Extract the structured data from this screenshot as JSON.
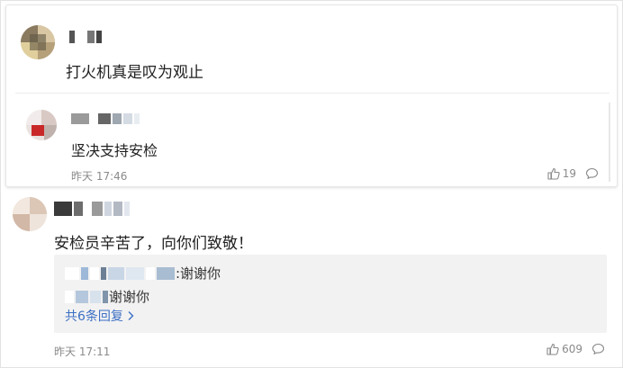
{
  "comments": [
    {
      "text": "打火机真是叹为观止",
      "reply": {
        "text": "坚决支持安检",
        "time": "昨天 17:46",
        "likes": "19"
      }
    },
    {
      "text": "安检员辛苦了，向你们致敬！",
      "replies_preview": [
        {
          "suffix": ":谢谢你"
        },
        {
          "suffix": "谢谢你"
        }
      ],
      "more_replies": "共6条回复",
      "time": "昨天 17:11",
      "likes": "609"
    }
  ],
  "icons": {
    "like": "thumbs-up-icon",
    "comment": "comment-bubble-icon",
    "chevron": "chevron-right-icon"
  },
  "colors": {
    "link": "#3c6fc4",
    "meta": "#8a8a8a",
    "nested_bg": "#f2f2f2"
  }
}
